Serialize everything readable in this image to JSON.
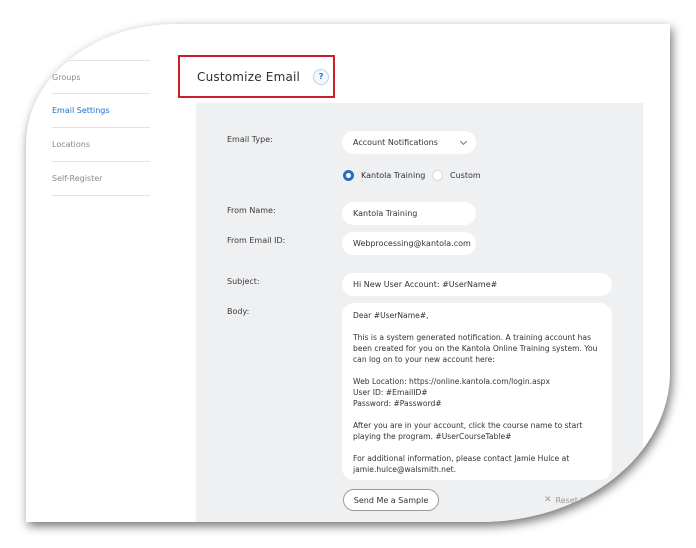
{
  "sidebar": {
    "items": [
      {
        "label": "Groups"
      },
      {
        "label": "Email Settings"
      },
      {
        "label": "Locations"
      },
      {
        "label": "Self-Register"
      }
    ]
  },
  "header": {
    "title": "Customize Email",
    "help_glyph": "?"
  },
  "form": {
    "email_type": {
      "label": "Email Type:",
      "value": "Account Notifications",
      "options": [
        {
          "label": "Kantola Training",
          "checked": true
        },
        {
          "label": "Custom",
          "checked": false
        }
      ]
    },
    "from_name": {
      "label": "From Name:",
      "value": "Kantola Training"
    },
    "from_email": {
      "label": "From Email ID:",
      "value": "Webprocessing@kantola.com"
    },
    "subject": {
      "label": "Subject:",
      "value": "Hi New User Account: #UserName#"
    },
    "body": {
      "label": "Body:",
      "lines": [
        "Dear #UserName#,",
        "This is a system generated notification. A training account has been created for you on the Kantola Online Training system. You can log on to your new account here:",
        "Web Location: https://online.kantola.com/login.aspx",
        "User ID: #EmailID#",
        "Password: #Password#",
        "After you are in your account, click the course name to start playing the program. #UserCourseTable#",
        "For additional information, please contact Jamie Hulce at jamie.hulce@walsmith.net."
      ]
    },
    "send_sample_label": "Send Me a Sample",
    "reset_label": "Reset to Default",
    "reset_glyph": "✕"
  },
  "colors": {
    "accent": "#1f6fc8",
    "highlight_border": "#cc1f2c",
    "panel_bg": "#eff0f2"
  }
}
